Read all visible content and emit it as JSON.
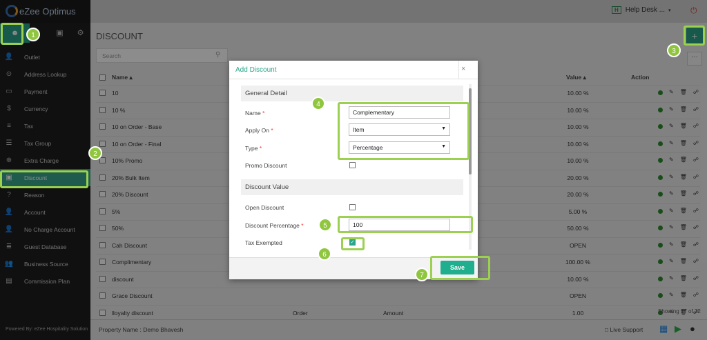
{
  "app": {
    "name": "eZee Optimus"
  },
  "header": {
    "helpdesk_badge": "H",
    "helpdesk_label": "Help Desk ...",
    "helpdesk_caret": "▾"
  },
  "page": {
    "title": "DISCOUNT",
    "search_placeholder": "Search",
    "add_label": "+",
    "more_label": "···"
  },
  "sidebar": {
    "top_icons": [
      "person-icon",
      "storefront-icon",
      "gear-icon"
    ],
    "items": [
      {
        "label": "Outlet",
        "icon": "person-icon",
        "glyph": "👤"
      },
      {
        "label": "Address Lookup",
        "icon": "map-pin-icon",
        "glyph": "⊙"
      },
      {
        "label": "Payment",
        "icon": "card-icon",
        "glyph": "▭"
      },
      {
        "label": "Currency",
        "icon": "dollar-icon",
        "glyph": "$"
      },
      {
        "label": "Tax",
        "icon": "list-icon",
        "glyph": "≡"
      },
      {
        "label": "Tax Group",
        "icon": "list-icon",
        "glyph": "☰"
      },
      {
        "label": "Extra Charge",
        "icon": "plus-circle-icon",
        "glyph": "⊕"
      },
      {
        "label": "Discount",
        "icon": "tag-icon",
        "glyph": "▣",
        "active": true
      },
      {
        "label": "Reason",
        "icon": "question-icon",
        "glyph": "?"
      },
      {
        "label": "Account",
        "icon": "person-icon",
        "glyph": "👤"
      },
      {
        "label": "No Charge Account",
        "icon": "person-icon",
        "glyph": "👤"
      },
      {
        "label": "Guest Database",
        "icon": "database-icon",
        "glyph": "≣"
      },
      {
        "label": "Business Source",
        "icon": "group-icon",
        "glyph": "👥"
      },
      {
        "label": "Commission Plan",
        "icon": "cash-icon",
        "glyph": "▤"
      }
    ],
    "powered_by": "Powered By: eZee Hospitality Solution"
  },
  "table": {
    "headers": {
      "name": "Name ▴",
      "value": "Value ▴",
      "action": "Action"
    },
    "rows": [
      {
        "name": "10",
        "value": "10.00 %"
      },
      {
        "name": "10 %",
        "value": "10.00 %"
      },
      {
        "name": "10 on Order - Base",
        "value": "10.00 %"
      },
      {
        "name": "10 on Order - Final",
        "value": "10.00 %"
      },
      {
        "name": "10% Promo",
        "value": "10.00 %"
      },
      {
        "name": "20% Bulk Item",
        "value": "20.00 %"
      },
      {
        "name": "20% Discount",
        "value": "20.00 %"
      },
      {
        "name": "5%",
        "value": "5.00 %"
      },
      {
        "name": "50%",
        "value": "50.00 %"
      },
      {
        "name": "Cah Discount",
        "value": "OPEN"
      },
      {
        "name": "Complimentary",
        "value": "100.00 %"
      },
      {
        "name": "discount",
        "value": "10.00 %"
      },
      {
        "name": "Grace Discount",
        "value": "OPEN"
      },
      {
        "name": "lloyalty discount",
        "apply_on": "Order",
        "type": "Amount",
        "value": "1.00"
      }
    ],
    "showing": "Showing 17 of 22"
  },
  "footer": {
    "property": "Property Name : Demo Bhavesh",
    "live_support": "Live Support"
  },
  "modal": {
    "title": "Add Discount",
    "close": "×",
    "sections": {
      "general": "General Detail",
      "value": "Discount Value"
    },
    "fields": {
      "name_label": "Name",
      "name_value": "Complementary",
      "apply_on_label": "Apply On",
      "apply_on_value": "Item",
      "type_label": "Type",
      "type_value": "Percentage",
      "promo_label": "Promo Discount",
      "open_label": "Open Discount",
      "percentage_label": "Discount Percentage",
      "percentage_value": "100",
      "tax_exempted_label": "Tax Exempted",
      "tax_exempted_checked": true
    },
    "required_mark": "*",
    "save_label": "Save"
  },
  "annotations": [
    "1",
    "2",
    "3",
    "4",
    "5",
    "6",
    "7"
  ],
  "colors": {
    "accent": "#2aa58a",
    "highlight": "#9bd050",
    "sidebar": "#1e1e1e"
  }
}
